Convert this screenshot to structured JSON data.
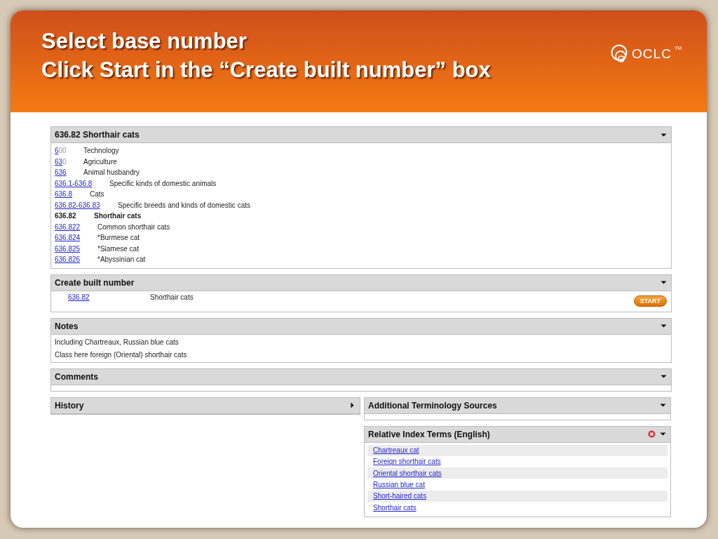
{
  "slide": {
    "title_lines": [
      "Select base number",
      "Click Start in the “Create built number” box"
    ],
    "logo": {
      "text": "OCLC",
      "mark": "TM"
    }
  },
  "hierarchy": {
    "title": "636.82 Shorthair cats",
    "expanded": true,
    "rows": [
      {
        "link": "6",
        "rest": "00",
        "caption": "Technology",
        "current": false
      },
      {
        "link": "63",
        "rest": "0",
        "caption": "Agriculture",
        "current": false
      },
      {
        "link": "636",
        "rest": "",
        "caption": "Animal husbandry",
        "current": false
      },
      {
        "link": "636.1-636.8",
        "rest": "",
        "caption": "Specific kinds of domestic animals",
        "current": false
      },
      {
        "link": "636.8",
        "rest": "",
        "caption": "Cats",
        "current": false
      },
      {
        "link": "636.82-636.83",
        "rest": "",
        "caption": "Specific breeds and kinds of domestic cats",
        "current": false
      },
      {
        "link": "636.82",
        "rest": "",
        "caption": "Shorthair cats",
        "current": true
      },
      {
        "link": "636.822",
        "rest": "",
        "caption": "Common shorthair cats",
        "current": false
      },
      {
        "link": "636.824",
        "rest": "",
        "caption": "*Burmese cat",
        "current": false
      },
      {
        "link": "636.825",
        "rest": "",
        "caption": "*Siamese cat",
        "current": false
      },
      {
        "link": "636.826",
        "rest": "",
        "caption": "*Abyssinian cat",
        "current": false
      }
    ]
  },
  "built_number": {
    "title": "Create built number",
    "expanded": true,
    "number": "636.82",
    "caption": "Shorthair cats",
    "button": "START"
  },
  "notes": {
    "title": "Notes",
    "expanded": true,
    "lines": [
      "Including Chartreaux, Russian blue cats",
      "Class here foreign (Oriental) shorthair cats"
    ]
  },
  "comments": {
    "title": "Comments",
    "expanded": true
  },
  "history": {
    "title": "History",
    "expanded": false
  },
  "terminology": {
    "title": "Additional Terminology Sources",
    "expanded": true
  },
  "index_terms": {
    "title": "Relative Index Terms (English)",
    "expanded": true,
    "terms": [
      "Chartreaux cat",
      "Foreign shorthair cats",
      "Oriental shorthair cats",
      "Russian blue cat",
      "Short-haired cats",
      "Shorthair cats"
    ]
  }
}
